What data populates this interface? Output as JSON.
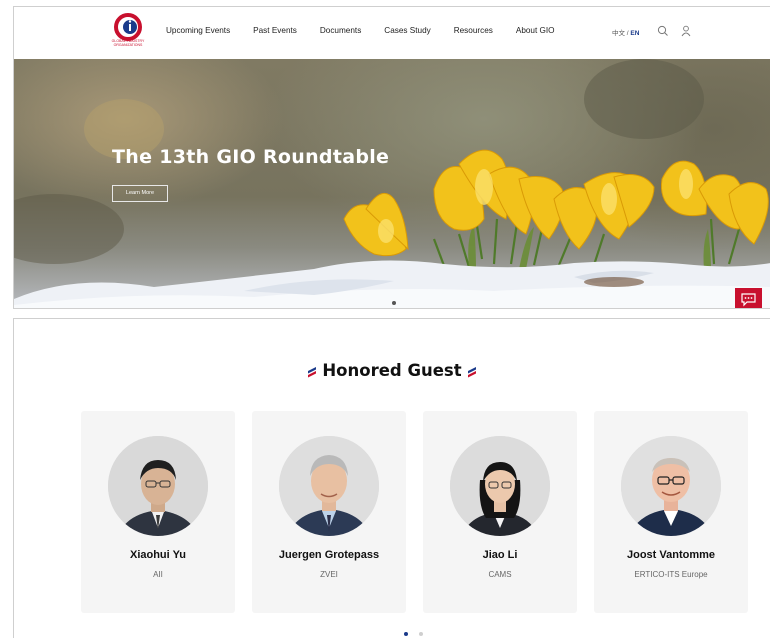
{
  "nav": {
    "logo_text": "GLOBAL INDUSTRY ORGANIZATIONS",
    "links": [
      "Upcoming Events",
      "Past Events",
      "Documents",
      "Cases Study",
      "Resources",
      "About GIO"
    ],
    "lang_cn": "中文",
    "lang_sep": " / ",
    "lang_en": "EN",
    "icons": [
      "search-icon",
      "user-icon"
    ]
  },
  "hero": {
    "title": "The 13th GIO Roundtable",
    "button": "Learn More",
    "slide_count": 1,
    "chat_icon": "chat-icon"
  },
  "guests": {
    "title": "Honored Guest",
    "items": [
      {
        "name": "Xiaohui Yu",
        "org": "AII"
      },
      {
        "name": "Juergen Grotepass",
        "org": "ZVEI"
      },
      {
        "name": "Jiao Li",
        "org": "CAMS"
      },
      {
        "name": "Joost Vantomme",
        "org": "ERTICO-ITS Europe"
      }
    ],
    "pages": 2,
    "active_page": 1
  },
  "colors": {
    "brand_red": "#c8102e",
    "brand_blue": "#1a3a8a",
    "card_bg": "#f5f5f5"
  }
}
